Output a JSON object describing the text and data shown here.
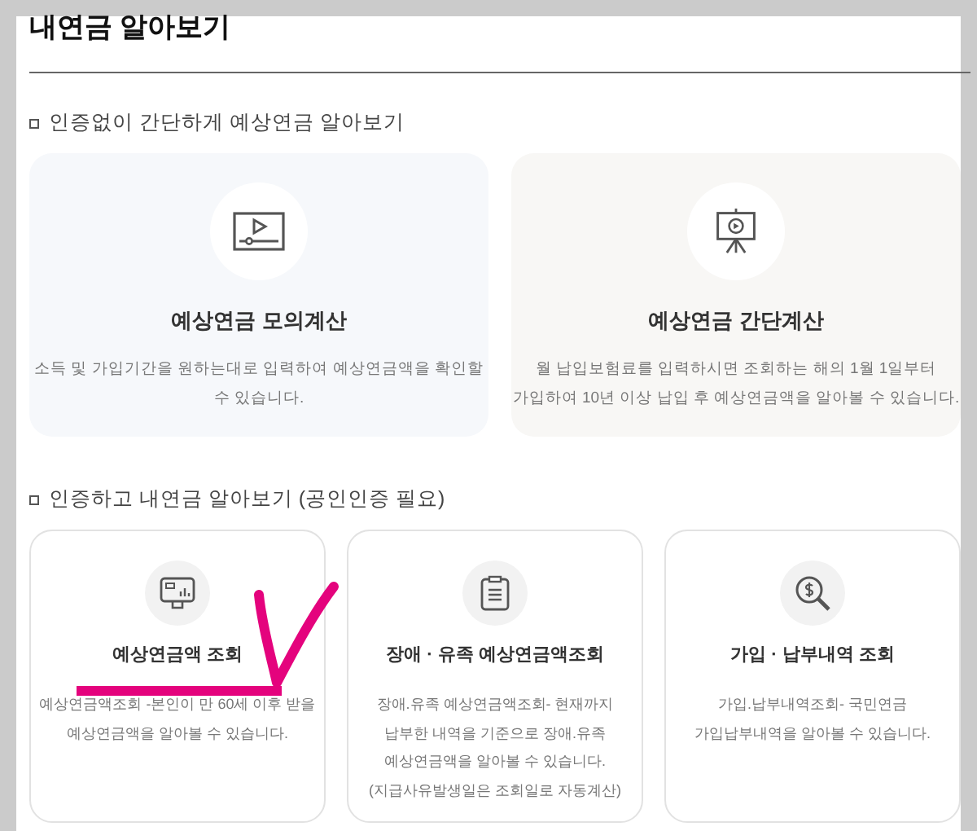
{
  "page_title": "내연금 알아보기",
  "sections": [
    {
      "heading": "인증없이 간단하게 예상연금 알아보기",
      "cards": [
        {
          "kind": "video",
          "title": "예상연금 모의계산",
          "description": [
            "소득 및 가입기간을 원하는대로 입력하여 예상연금액을 확인할",
            "수 있습니다."
          ]
        },
        {
          "kind": "easel",
          "title": "예상연금 간단계산",
          "description": [
            "월 납입보험료를 입력하시면 조회하는 해의 1월 1일부터",
            "가입하여 10년 이상 납입 후 예상연금액을 알아볼 수 있습니다."
          ]
        }
      ]
    },
    {
      "heading": "인증하고 내연금 알아보기 (공인인증 필요)",
      "cards": [
        {
          "kind": "monitor",
          "title": "예상연금액 조회",
          "description": [
            "예상연금액조회 -본인이 만 60세 이후 받을",
            "예상연금액을 알아볼 수 있습니다."
          ]
        },
        {
          "kind": "clipboard",
          "title": "장애 · 유족 예상연금액조회",
          "description": [
            "장애.유족 예상연금액조회- 현재까지",
            "납부한 내역을 기준으로 장애.유족",
            "예상연금액을 알아볼 수 있습니다.",
            "(지급사유발생일은 조회일로 자동계산)"
          ]
        },
        {
          "kind": "magnifier",
          "title": "가입 · 납부내역 조회",
          "description": [
            "가입.납부내역조회- 국민연금",
            "가입납부내역을 알아볼 수 있습니다."
          ]
        }
      ]
    }
  ]
}
